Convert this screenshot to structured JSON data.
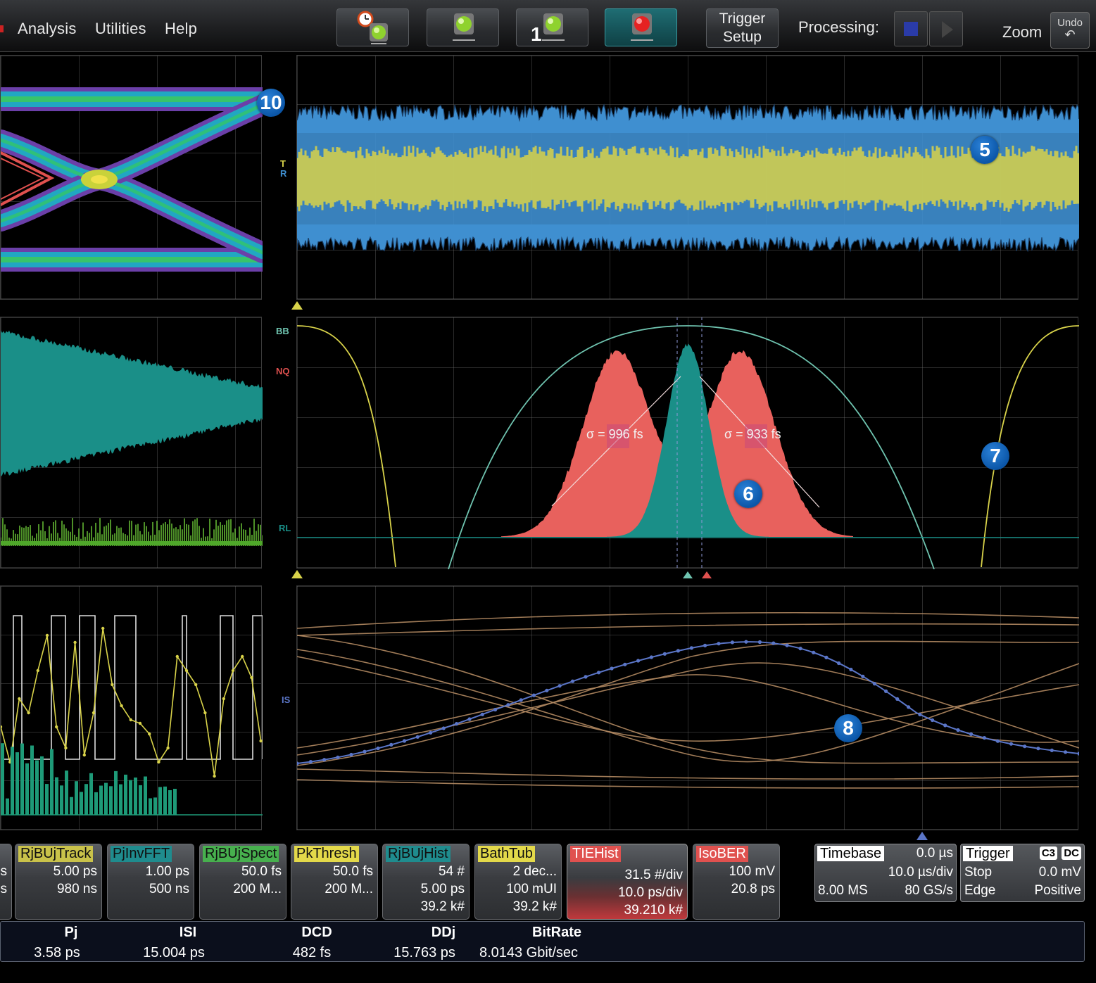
{
  "menu": {
    "items": [
      "Analysis",
      "Utilities",
      "Help"
    ]
  },
  "toolbar": {
    "single_trigger_number": "1",
    "trigger_setup": [
      "Trigger",
      "Setup"
    ],
    "processing_label": "Processing:",
    "zoom_label": "Zoom",
    "undo_label": "Undo",
    "undo_glyph": "↶"
  },
  "grids": {
    "top_right_labels": [
      "T",
      "R"
    ],
    "mid_right_labels": [
      "BB",
      "NQ",
      "RL"
    ],
    "bottom_right_label": "IS",
    "bathtub_sigma_left": "σ = 996 fs",
    "bathtub_sigma_right": "σ = 933 fs"
  },
  "badges": {
    "eye": "10",
    "track": "5",
    "hist": "6",
    "bathtub": "7",
    "isi": "8"
  },
  "descriptors": [
    {
      "title": "",
      "color": "#6b6d70",
      "text_color": "#fff",
      "lines": [
        "s",
        "s"
      ]
    },
    {
      "title": "RjBUjTrack",
      "color": "#c9c24a",
      "text_color": "#111",
      "lines": [
        "5.00 ps",
        "980 ns"
      ]
    },
    {
      "title": "PjInvFFT",
      "color": "#1f8c8e",
      "text_color": "#111",
      "lines": [
        "1.00 ps",
        "500 ns"
      ]
    },
    {
      "title": "RjBUjSpect",
      "color": "#47b04e",
      "text_color": "#111",
      "lines": [
        "50.0 fs",
        "200 M..."
      ]
    },
    {
      "title": "PkThresh",
      "color": "#e3d94a",
      "text_color": "#111",
      "lines": [
        "50.0 fs",
        "200 M..."
      ]
    },
    {
      "title": "RjBUjHist",
      "color": "#1f8c8e",
      "text_color": "#111",
      "lines": [
        "54 #",
        "5.00 ps",
        "39.2 k#"
      ]
    },
    {
      "title": "BathTub",
      "color": "#e3d94a",
      "text_color": "#111",
      "lines": [
        "2 dec...",
        "100 mUI",
        "39.2 k#"
      ]
    },
    {
      "title": "TIEHist",
      "color": "#e0514f",
      "text_color": "#fff",
      "lines": [
        "31.5 #/div",
        "10.0 ps/div",
        "39.210 k#"
      ]
    },
    {
      "title": "IsoBER",
      "color": "#e0514f",
      "text_color": "#fff",
      "lines": [
        "100 mV",
        "20.8 ps"
      ]
    }
  ],
  "timebase": {
    "title": "Timebase",
    "delay": "0.0 µs",
    "per_div": "10.0 µs/div",
    "samples": "8.00 MS",
    "rate": "80 GS/s"
  },
  "trigger": {
    "title": "Trigger",
    "channel": "C3",
    "coupling": "DC",
    "mode": "Stop",
    "level": "0.0 mV",
    "type": "Edge",
    "slope": "Positive"
  },
  "measurements": [
    {
      "name": "Pj",
      "value": "3.58 ps"
    },
    {
      "name": "ISI",
      "value": "15.004 ps"
    },
    {
      "name": "DCD",
      "value": "482 fs"
    },
    {
      "name": "DDj",
      "value": "15.763 ps"
    },
    {
      "name": "BitRate",
      "value": "8.0143 Gbit/sec"
    }
  ],
  "colors": {
    "yellow": "#d9d34a",
    "blue_trace": "#3f8fd0",
    "teal": "#1a8f88",
    "salmon": "#e8615d",
    "cyan_curve": "#6fc4b0",
    "isi_brown": "#b38a62",
    "isi_blue": "#5b76c8",
    "badge": "#0b56a8"
  }
}
